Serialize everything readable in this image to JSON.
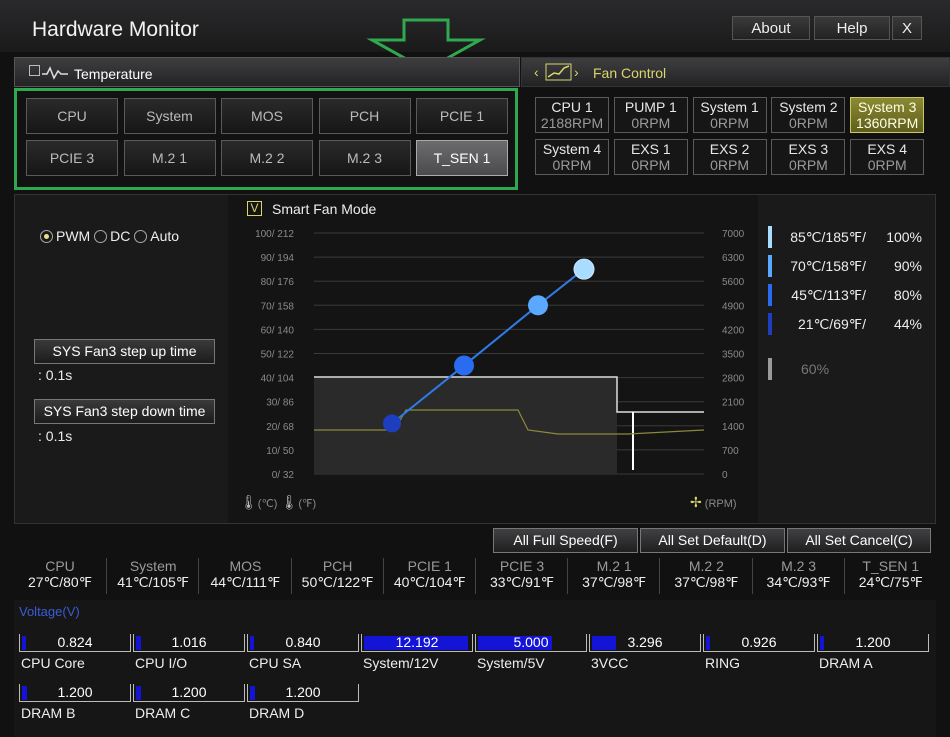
{
  "window": {
    "title": "Hardware Monitor"
  },
  "titlebar_buttons": {
    "about": "About",
    "help": "Help",
    "close": "X"
  },
  "temperature": {
    "header": "Temperature",
    "sensors": [
      "CPU",
      "System",
      "MOS",
      "PCH",
      "PCIE 1",
      "PCIE 3",
      "M.2 1",
      "M.2 2",
      "M.2 3",
      "T_SEN 1"
    ],
    "selected": "T_SEN 1"
  },
  "fan_control": {
    "header": "Fan Control",
    "fans": [
      {
        "name": "CPU 1",
        "rpm": "2188RPM"
      },
      {
        "name": "PUMP 1",
        "rpm": "0RPM"
      },
      {
        "name": "System 1",
        "rpm": "0RPM"
      },
      {
        "name": "System 2",
        "rpm": "0RPM"
      },
      {
        "name": "System 3",
        "rpm": "1360RPM"
      },
      {
        "name": "System 4",
        "rpm": "0RPM"
      },
      {
        "name": "EXS 1",
        "rpm": "0RPM"
      },
      {
        "name": "EXS 2",
        "rpm": "0RPM"
      },
      {
        "name": "EXS 3",
        "rpm": "0RPM"
      },
      {
        "name": "EXS 4",
        "rpm": "0RPM"
      }
    ],
    "selected": "System 3"
  },
  "mode": {
    "pwm": "PWM",
    "dc": "DC",
    "auto": "Auto",
    "selected": "PWM",
    "smart_fan_label": "Smart Fan Mode",
    "smart_fan_check": "V",
    "step_up_label": "SYS Fan3 step up time",
    "step_up_value": ": 0.1s",
    "step_down_label": "SYS Fan3 step down time",
    "step_down_value": ": 0.1s"
  },
  "chart_data": {
    "type": "line",
    "y_left_ticks": [
      "100/ 212",
      "90/ 194",
      "80/ 176",
      "70/ 158",
      "60/ 140",
      "50/ 122",
      "40/ 104",
      "30/  86",
      "20/  68",
      "10/  50",
      "0/  32"
    ],
    "y_right_ticks": [
      "7000",
      "6300",
      "5600",
      "4900",
      "4200",
      "3500",
      "2800",
      "2100",
      "1400",
      "700",
      "0"
    ],
    "xunit_c": "(℃)",
    "xunit_f": "(℉)",
    "rpm_unit": "(RPM)",
    "curve_points": [
      {
        "temp_c": 21,
        "fan_pct": 44
      },
      {
        "temp_c": 45,
        "fan_pct": 80
      },
      {
        "temp_c": 70,
        "fan_pct": 90
      },
      {
        "temp_c": 85,
        "fan_pct": 100
      }
    ],
    "legend": [
      {
        "temp": "85℃/185℉/",
        "pct": "100%",
        "color": "#a9ddff"
      },
      {
        "temp": "70℃/158℉/",
        "pct": "90%",
        "color": "#5aa8ff"
      },
      {
        "temp": "45℃/113℉/",
        "pct": "80%",
        "color": "#2a6cf0"
      },
      {
        "temp": "21℃/69℉/",
        "pct": "44%",
        "color": "#1d3fbf"
      }
    ],
    "min_pct": "60%",
    "ylim": [
      0,
      100
    ]
  },
  "actions": {
    "full_speed": "All Full Speed(F)",
    "set_default": "All Set Default(D)",
    "set_cancel": "All Set Cancel(C)"
  },
  "temps": [
    {
      "name": "CPU",
      "value": "27℃/80℉"
    },
    {
      "name": "System",
      "value": "41℃/105℉"
    },
    {
      "name": "MOS",
      "value": "44℃/111℉"
    },
    {
      "name": "PCH",
      "value": "50℃/122℉"
    },
    {
      "name": "PCIE 1",
      "value": "40℃/104℉"
    },
    {
      "name": "PCIE 3",
      "value": "33℃/91℉"
    },
    {
      "name": "M.2 1",
      "value": "37℃/98℉"
    },
    {
      "name": "M.2 2",
      "value": "37℃/98℉"
    },
    {
      "name": "M.2 3",
      "value": "34℃/93℉"
    },
    {
      "name": "T_SEN 1",
      "value": "24℃/75℉"
    }
  ],
  "voltage": {
    "header": "Voltage(V)",
    "items": [
      {
        "name": "CPU Core",
        "value": "0.824",
        "fill": 0.04
      },
      {
        "name": "CPU I/O",
        "value": "1.016",
        "fill": 0.05
      },
      {
        "name": "CPU SA",
        "value": "0.840",
        "fill": 0.04
      },
      {
        "name": "System/12V",
        "value": "12.192",
        "fill": 0.98
      },
      {
        "name": "System/5V",
        "value": "5.000",
        "fill": 0.7
      },
      {
        "name": "3VCC",
        "value": "3.296",
        "fill": 0.23
      },
      {
        "name": "RING",
        "value": "0.926",
        "fill": 0.04
      },
      {
        "name": "DRAM A",
        "value": "1.200",
        "fill": 0.04
      },
      {
        "name": "DRAM B",
        "value": "1.200",
        "fill": 0.05
      },
      {
        "name": "DRAM C",
        "value": "1.200",
        "fill": 0.05
      },
      {
        "name": "DRAM D",
        "value": "1.200",
        "fill": 0.05
      }
    ]
  },
  "colors": {
    "accent_yellow": "#d8d56a",
    "highlight_green": "#2fa84f",
    "bar_blue": "#1414d6"
  }
}
